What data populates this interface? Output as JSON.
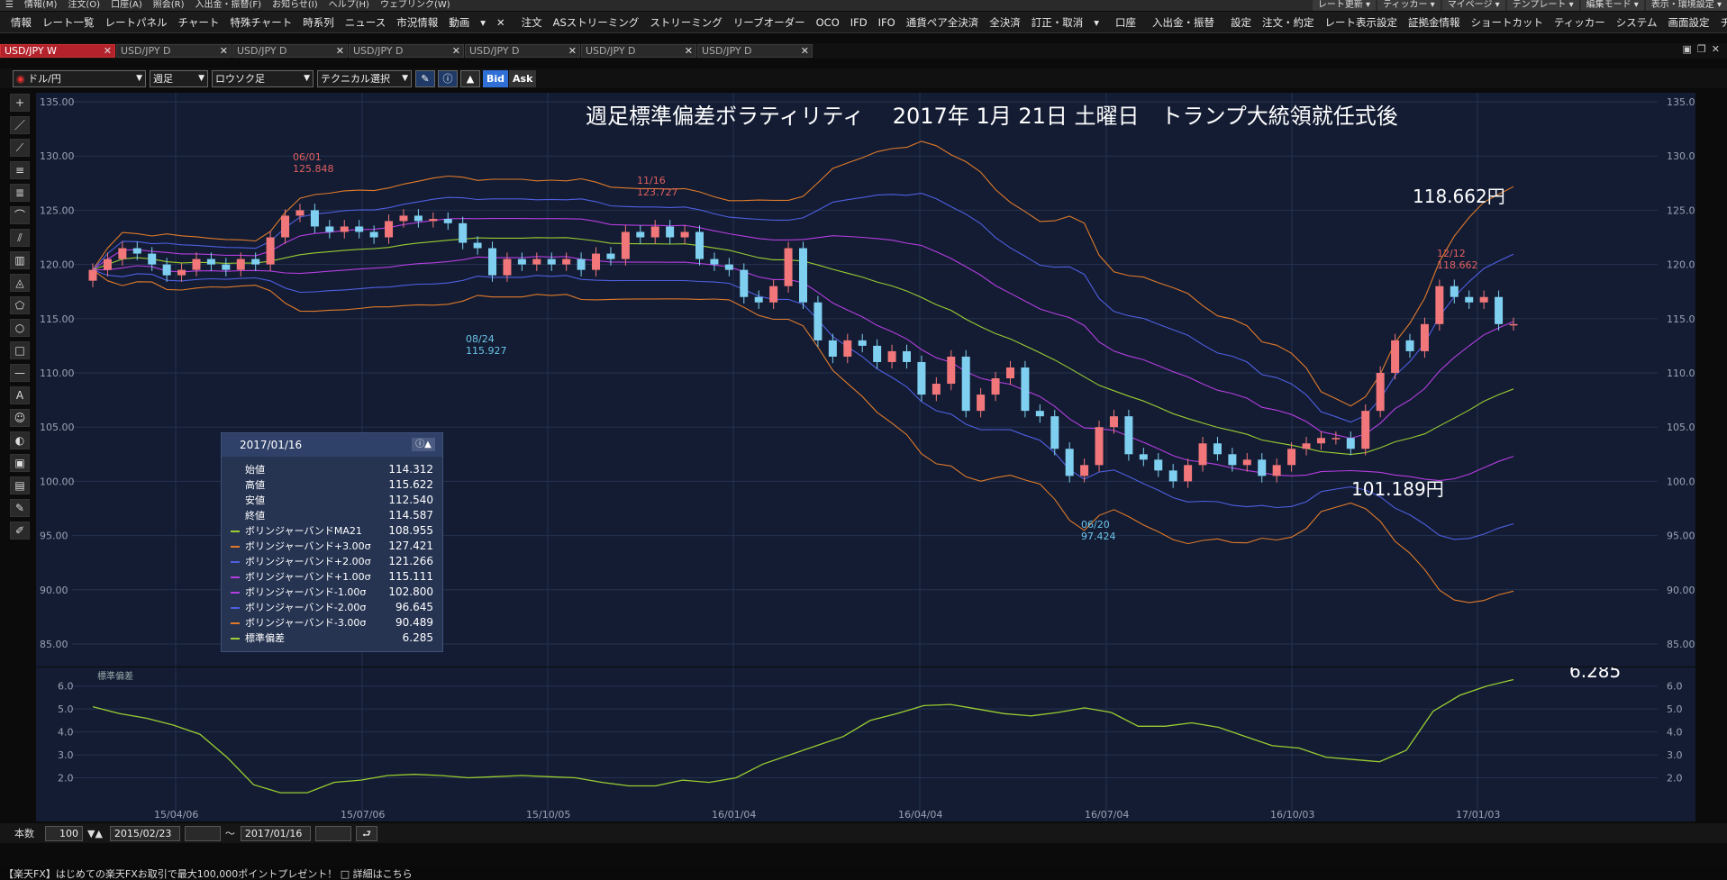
{
  "menubar": {
    "items": [
      "情報(M)",
      "注文(O)",
      "口座(A)",
      "照会(R)",
      "入出金・振替(F)",
      "お知らせ(I)",
      "ヘルプ(H)",
      "ウェブリンク(W)"
    ],
    "right_items": [
      "レート更新 ▾",
      "ティッカー ▾",
      "マイページ ▾",
      "テンプレート ▾",
      "編集モード ▾",
      "表示・環境設定 ▾"
    ]
  },
  "toolbar": {
    "items": [
      "情報",
      "レート一覧",
      "レートパネル",
      "チャート",
      "特殊チャート",
      "時系列",
      "ニュース",
      "市況情報",
      "動画",
      "▾",
      "✕",
      "注文",
      "ASストリーミング",
      "ストリーミング",
      "リーブオーダー",
      "OCO",
      "IFD",
      "IFO",
      "通貨ペア全決済",
      "全決済",
      "訂正・取消",
      "▾",
      "口座",
      "入出金・振替",
      "設定",
      "注文・約定",
      "レート表示設定",
      "証拠金情報",
      "ショートカット",
      "ティッカー",
      "システム",
      "画面設定",
      "チャート",
      "▾"
    ],
    "accent_colors": {
      "info": "#d03030",
      "order": "#8a2be2",
      "account": "#ff8c00",
      "deposit": "#2ecc40",
      "settings": "#ff6a00"
    }
  },
  "tabs": [
    {
      "label": "USD/JPY W",
      "active": true
    },
    {
      "label": "USD/JPY D",
      "active": false
    },
    {
      "label": "USD/JPY D",
      "active": false
    },
    {
      "label": "USD/JPY D",
      "active": false
    },
    {
      "label": "USD/JPY D",
      "active": false
    },
    {
      "label": "USD/JPY D",
      "active": false
    },
    {
      "label": "USD/JPY D",
      "active": false
    }
  ],
  "chartbar": {
    "pair": "ドル/円",
    "period": "週足",
    "chart_type": "ロウソク足",
    "technical": "テクニカル選択",
    "bid": "Bid",
    "ask": "Ask"
  },
  "lefttools": [
    "+",
    "／",
    "⟋",
    "≡",
    "≣",
    "⌒",
    "⫽",
    "▥",
    "◬",
    "⬠",
    "○",
    "□",
    "—",
    "A",
    "☺",
    "◐",
    "▣",
    "▤",
    "✎",
    "✐"
  ],
  "annotations": {
    "title": "週足標準偏差ボラティリティ　 2017年 1月 21日 土曜日　トランプ大統領就任式後",
    "high_label": "118.662円",
    "low_label": "101.189円",
    "sd_label": "6.285"
  },
  "marks": {
    "m1": {
      "date": "06/01",
      "price": "125.848"
    },
    "m2": {
      "date": "08/24",
      "price": "115.927"
    },
    "m3": {
      "date": "11/16",
      "price": "123.727"
    },
    "m4": {
      "date": "06/20",
      "price": "97.424"
    },
    "m5": {
      "date": "12/12",
      "price": "118.662"
    }
  },
  "infopanel": {
    "date": "2017/01/16",
    "rows": [
      {
        "label": "始値",
        "value": "114.312",
        "color": ""
      },
      {
        "label": "高値",
        "value": "115.622",
        "color": ""
      },
      {
        "label": "安値",
        "value": "112.540",
        "color": ""
      },
      {
        "label": "終値",
        "value": "114.587",
        "color": ""
      },
      {
        "label": "ボリンジャーバンドMA21",
        "value": "108.955",
        "color": "#9acd32"
      },
      {
        "label": "ボリンジャーバンド+3.00σ",
        "value": "127.421",
        "color": "#e07a2a"
      },
      {
        "label": "ボリンジャーバンド+2.00σ",
        "value": "121.266",
        "color": "#4f5fe0"
      },
      {
        "label": "ボリンジャーバンド+1.00σ",
        "value": "115.111",
        "color": "#b43ee0"
      },
      {
        "label": "ボリンジャーバンド-1.00σ",
        "value": "102.800",
        "color": "#b43ee0"
      },
      {
        "label": "ボリンジャーバンド-2.00σ",
        "value": "96.645",
        "color": "#4f5fe0"
      },
      {
        "label": "ボリンジャーバンド-3.00σ",
        "value": "90.489",
        "color": "#e07a2a"
      },
      {
        "label": "標準偏差",
        "value": "6.285",
        "color": "#9acd32"
      }
    ]
  },
  "subchart": {
    "label": "標準偏差"
  },
  "bottombar": {
    "count_label": "本数",
    "count": "100",
    "from": "2015/02/23",
    "tilde": "～",
    "to": "2017/01/16"
  },
  "news": "【楽天FX】はじめての楽天FXお取引で最大100,000ポイントプレゼント！ □ 詳細はこちら",
  "chart_data": [
    {
      "type": "candlestick",
      "title": "週足標準偏差ボラティリティ　 2017年 1月 21日 土曜日　トランプ大統領就任式後",
      "ylim": [
        85,
        135
      ],
      "yticks": [
        "135.00",
        "130.00",
        "125.00",
        "120.00",
        "115.00",
        "110.00",
        "105.00",
        "100.00",
        "95.00",
        "90.00",
        "85.00"
      ],
      "xticks": [
        "15/04/06",
        "15/07/06",
        "15/10/05",
        "16/01/04",
        "16/04/04",
        "16/07/04",
        "16/10/03",
        "17/01/03"
      ],
      "close": [
        119.5,
        120.5,
        121.5,
        121.0,
        120.0,
        119.0,
        119.5,
        120.5,
        120.0,
        119.5,
        120.5,
        120.0,
        122.5,
        124.5,
        125.0,
        123.5,
        123.0,
        123.5,
        123.0,
        122.5,
        124.0,
        124.5,
        124.0,
        124.2,
        123.8,
        122.0,
        121.5,
        119.0,
        120.5,
        120.0,
        120.5,
        120.0,
        120.5,
        119.5,
        121.0,
        120.5,
        123.0,
        122.5,
        123.5,
        122.5,
        123.0,
        120.5,
        120.0,
        119.5,
        117.0,
        116.5,
        118.0,
        121.5,
        116.5,
        113.0,
        111.5,
        113.0,
        112.5,
        111.0,
        112.0,
        111.0,
        108.0,
        109.0,
        111.5,
        106.5,
        108.0,
        109.5,
        110.5,
        106.5,
        106.0,
        103.0,
        100.5,
        101.5,
        105.0,
        106.0,
        102.5,
        102.0,
        101.0,
        100.0,
        101.5,
        103.5,
        102.5,
        101.5,
        102.0,
        100.5,
        101.5,
        103.0,
        103.5,
        104.0,
        104.0,
        103.0,
        106.5,
        110.0,
        113.0,
        112.0,
        114.5,
        118.0,
        117.0,
        116.5,
        117.0,
        114.5,
        114.5
      ],
      "bands": {
        "ma21_last": 108.955,
        "plus3_last": 127.421,
        "plus2_last": 121.266,
        "plus1_last": 115.111,
        "minus1_last": 102.8,
        "minus2_last": 96.645,
        "minus3_last": 90.489
      }
    },
    {
      "type": "line",
      "title": "標準偏差",
      "ylim": [
        1,
        6.5
      ],
      "yticks": [
        "6.0",
        "5.0",
        "4.0",
        "3.0",
        "2.0"
      ],
      "values": [
        5.1,
        4.8,
        4.6,
        4.3,
        3.9,
        2.9,
        1.7,
        1.35,
        1.35,
        1.8,
        1.9,
        2.1,
        2.15,
        2.1,
        2.0,
        2.05,
        2.1,
        2.05,
        2.0,
        1.8,
        1.65,
        1.65,
        1.9,
        1.8,
        2.0,
        2.6,
        3.0,
        3.4,
        3.8,
        4.5,
        4.8,
        5.15,
        5.2,
        5.0,
        4.8,
        4.7,
        4.85,
        5.05,
        4.85,
        4.25,
        4.25,
        4.4,
        4.2,
        3.8,
        3.4,
        3.3,
        2.9,
        2.8,
        2.7,
        3.2,
        4.9,
        5.6,
        6.0,
        6.285
      ],
      "last": 6.285
    }
  ]
}
